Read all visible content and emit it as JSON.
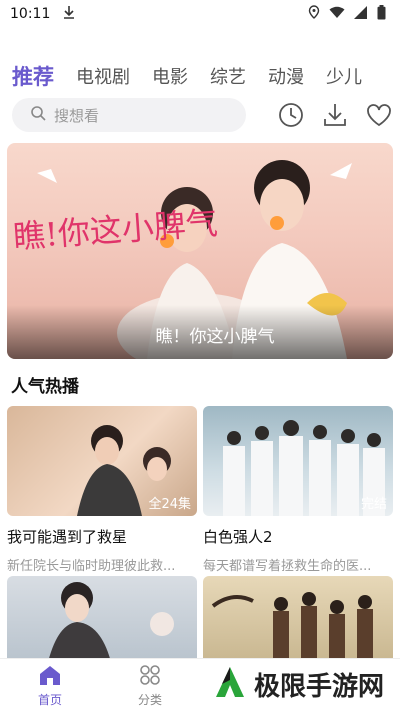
{
  "status_bar": {
    "time": "10:11"
  },
  "tabs": [
    "推荐",
    "电视剧",
    "电影",
    "综艺",
    "动漫",
    "少儿"
  ],
  "search": {
    "placeholder": "搜想看"
  },
  "banner": {
    "title": "瞧！你这小脾气",
    "art_text": "瞧!你这小脾气"
  },
  "section": {
    "title": "人气热播"
  },
  "cards": [
    {
      "title": "我可能遇到了救星",
      "desc": "新任院长与临时助理彼此救...",
      "badge": "全24集"
    },
    {
      "title": "白色强人2",
      "desc": "每天都谱写着拯救生命的医...",
      "badge": "完结"
    },
    {
      "title": "",
      "desc": "",
      "badge": ""
    },
    {
      "title": "",
      "desc": "",
      "badge": ""
    }
  ],
  "bottom_nav": [
    {
      "label": "首页",
      "icon": "home-icon"
    },
    {
      "label": "分类",
      "icon": "grid-icon"
    }
  ],
  "watermark": {
    "text": "极限手游网"
  },
  "colors": {
    "accent": "#6a5acd",
    "text": "#222222",
    "muted": "#999999"
  }
}
